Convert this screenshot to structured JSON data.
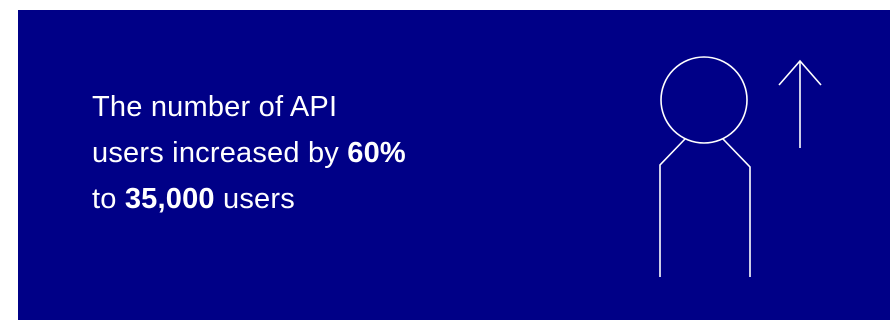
{
  "banner": {
    "line1": "The number of API",
    "line2_prefix": "users increased by ",
    "line2_highlight": "60%",
    "line3_prefix": "to ",
    "line3_highlight": "35,000",
    "line3_suffix": " users"
  },
  "colors": {
    "background": "#000087",
    "text": "#ffffff",
    "illustration_stroke": "#ffffff"
  },
  "icons": {
    "person": "person-outline-icon",
    "growth": "arrow-up-icon"
  }
}
